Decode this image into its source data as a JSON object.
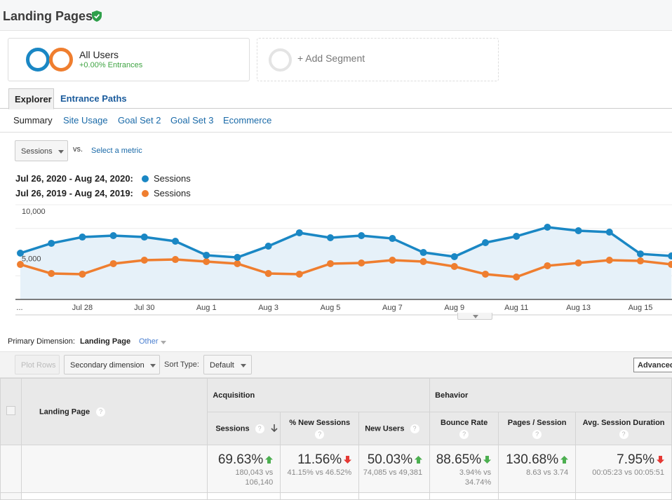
{
  "header": {
    "title": "Landing Pages",
    "verified_icon": "shield-check-icon",
    "verified_color": "#2e9f4a"
  },
  "segments": {
    "active": {
      "name": "All Users",
      "subtitle": "+0.00% Entrances",
      "colors": [
        "#1a87c4",
        "#ef7e2f"
      ]
    },
    "add_label": "+ Add Segment"
  },
  "tabs": [
    {
      "label": "Explorer",
      "active": true
    },
    {
      "label": "Entrance Paths",
      "active": false
    }
  ],
  "subtabs": [
    {
      "label": "Summary",
      "active": true
    },
    {
      "label": "Site Usage",
      "active": false
    },
    {
      "label": "Goal Set 2",
      "active": false
    },
    {
      "label": "Goal Set 3",
      "active": false
    },
    {
      "label": "Ecommerce",
      "active": false
    }
  ],
  "metric_picker": {
    "selected": "Sessions",
    "vs_label": "vs.",
    "select_metric": "Select a metric"
  },
  "legend": [
    {
      "range": "Jul 26, 2020 - Aug 24, 2020:",
      "metric": "Sessions",
      "color": "#1a87c4"
    },
    {
      "range": "Jul 26, 2019 - Aug 24, 2019:",
      "metric": "Sessions",
      "color": "#ef7e2f"
    }
  ],
  "chart_data": {
    "type": "line",
    "title": "",
    "xlabel": "",
    "ylabel": "Sessions",
    "ylim": [
      0,
      10000
    ],
    "y_ticks_labeled": [
      "10,000",
      "5,000"
    ],
    "y_tick_values": [
      10000,
      5000
    ],
    "gridlines": [
      0,
      2500,
      5000,
      7500,
      10000
    ],
    "grid": true,
    "legend_position": "top-left",
    "x": [
      "Jul 26",
      "Jul 27",
      "Jul 28",
      "Jul 29",
      "Jul 30",
      "Jul 31",
      "Aug 1",
      "Aug 2",
      "Aug 3",
      "Aug 4",
      "Aug 5",
      "Aug 6",
      "Aug 7",
      "Aug 8",
      "Aug 9",
      "Aug 10",
      "Aug 11",
      "Aug 12",
      "Aug 13",
      "Aug 14",
      "Aug 15",
      "Aug 16"
    ],
    "x_tick_labels": [
      {
        "index": 0,
        "label": "..."
      },
      {
        "index": 2,
        "label": "Jul 28"
      },
      {
        "index": 4,
        "label": "Jul 30"
      },
      {
        "index": 6,
        "label": "Aug 1"
      },
      {
        "index": 8,
        "label": "Aug 3"
      },
      {
        "index": 10,
        "label": "Aug 5"
      },
      {
        "index": 12,
        "label": "Aug 7"
      },
      {
        "index": 14,
        "label": "Aug 9"
      },
      {
        "index": 16,
        "label": "Aug 11"
      },
      {
        "index": 18,
        "label": "Aug 13"
      },
      {
        "index": 20,
        "label": "Aug 15"
      }
    ],
    "series": [
      {
        "name": "Sessions (Jul 26, 2020 - Aug 24, 2020)",
        "color": "#1a87c4",
        "area": true,
        "values": [
          4890,
          5930,
          6590,
          6740,
          6590,
          6150,
          4670,
          4440,
          5630,
          7040,
          6520,
          6740,
          6440,
          4960,
          4520,
          6000,
          6670,
          7630,
          7260,
          7110,
          4810,
          4590
        ]
      },
      {
        "name": "Sessions (Jul 26, 2019 - Aug 24, 2019)",
        "color": "#ef7e2f",
        "area": false,
        "values": [
          3700,
          2740,
          2670,
          3780,
          4150,
          4220,
          4000,
          3780,
          2740,
          2670,
          3780,
          3850,
          4150,
          4000,
          3480,
          2670,
          2370,
          3560,
          3850,
          4150,
          4070,
          3700
        ]
      }
    ]
  },
  "primary_dimension": {
    "label": "Primary Dimension:",
    "current": "Landing Page",
    "other": "Other"
  },
  "toolbar": {
    "plot_rows": "Plot Rows",
    "secondary_dimension": "Secondary dimension",
    "sort_type_label": "Sort Type:",
    "sort_type_value": "Default",
    "advanced": "Advanced"
  },
  "table": {
    "dimension_header": "Landing Page",
    "groups": [
      {
        "label": "Acquisition"
      },
      {
        "label": "Behavior"
      }
    ],
    "columns": [
      {
        "label": "Sessions",
        "sorted": "desc"
      },
      {
        "label": "% New Sessions"
      },
      {
        "label": "New Users"
      },
      {
        "label": "Bounce Rate"
      },
      {
        "label": "Pages / Session"
      },
      {
        "label": "Avg. Session Duration"
      }
    ],
    "summary": [
      {
        "change": "69.63%",
        "direction": "up",
        "good": true,
        "detail": [
          "180,043 vs",
          "106,140"
        ]
      },
      {
        "change": "11.56%",
        "direction": "down",
        "good": false,
        "detail": [
          "41.15% vs 46.52%"
        ]
      },
      {
        "change": "50.03%",
        "direction": "up",
        "good": true,
        "detail": [
          "74,085 vs 49,381"
        ]
      },
      {
        "change": "88.65%",
        "direction": "down",
        "good": true,
        "detail": [
          "3.94% vs",
          "34.74%"
        ]
      },
      {
        "change": "130.68%",
        "direction": "up",
        "good": true,
        "detail": [
          "8.63 vs 3.74"
        ]
      },
      {
        "change": "7.95%",
        "direction": "down",
        "good": false,
        "detail": [
          "00:05:23 vs 00:05:51"
        ]
      }
    ],
    "colors": {
      "good": "#4caf50",
      "bad": "#e53935"
    }
  }
}
